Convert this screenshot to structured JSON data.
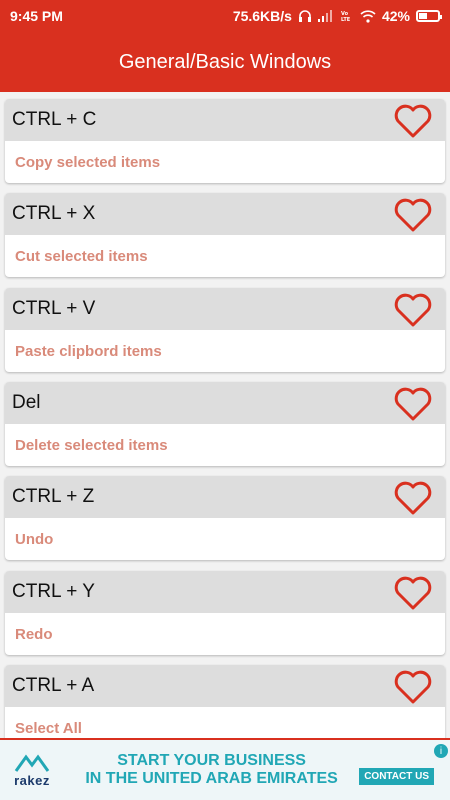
{
  "status_bar": {
    "time": "9:45 PM",
    "network_speed": "75.6KB/s",
    "battery_percent": "42%",
    "battery_level": 0.42
  },
  "app_bar": {
    "title": "General/Basic Windows"
  },
  "shortcuts": [
    {
      "keys": "CTRL + C",
      "description": "Copy selected items"
    },
    {
      "keys": "CTRL + X",
      "description": "Cut selected items"
    },
    {
      "keys": "CTRL + V",
      "description": "Paste clipbord items"
    },
    {
      "keys": "Del",
      "description": "Delete selected items"
    },
    {
      "keys": "CTRL + Z",
      "description": "Undo"
    },
    {
      "keys": "CTRL + Y",
      "description": "Redo"
    },
    {
      "keys": "CTRL + A",
      "description": "Select All"
    }
  ],
  "ad": {
    "brand": "rakez",
    "headline_line1": "START YOUR BUSINESS",
    "headline_line2": "IN THE UNITED ARAB EMIRATES",
    "cta": "CONTACT US"
  },
  "colors": {
    "primary": "#d9301f",
    "description_text": "#d98a7a",
    "card_header": "#dddddd",
    "ad_accent": "#21a7b5"
  }
}
